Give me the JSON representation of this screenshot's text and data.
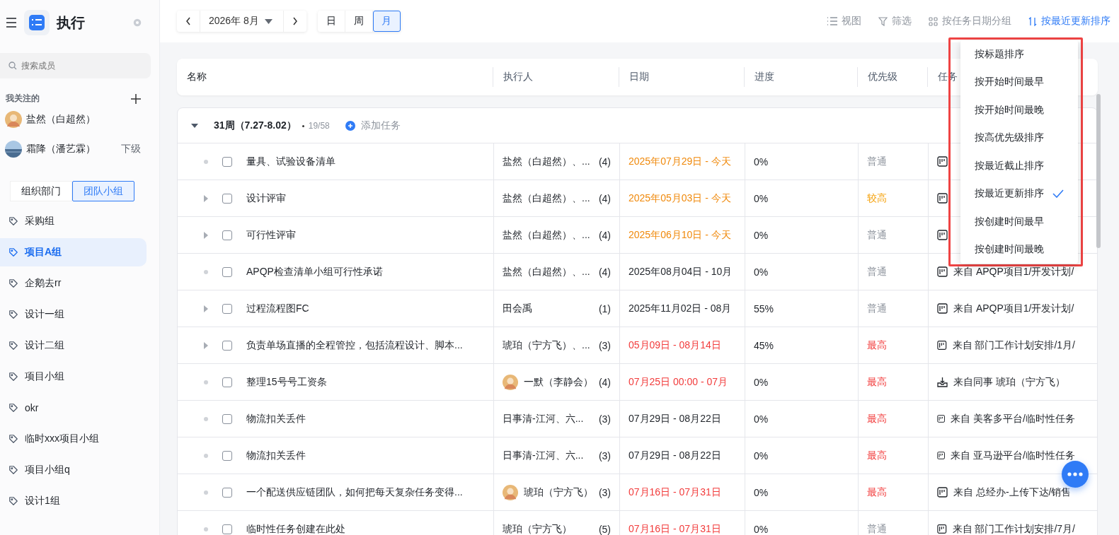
{
  "app": {
    "title": "执行"
  },
  "sidebar": {
    "search": {
      "placeholder": "搜索成员"
    },
    "following_title": "我关注的",
    "members": [
      {
        "name": "盐然（白超然）",
        "avatar": {
          "kind": "person"
        }
      },
      {
        "name": "霜降（潘艺霖）",
        "avatar": {
          "kind": "sea"
        },
        "tag": "下级"
      }
    ],
    "tabs": [
      {
        "label": "组织部门",
        "selected": false
      },
      {
        "label": "团队小组",
        "selected": true
      }
    ],
    "groups": [
      {
        "label": "采购组",
        "selected": false
      },
      {
        "label": "项目A组",
        "selected": true
      },
      {
        "label": "企鹅去rr",
        "selected": false
      },
      {
        "label": "设计一组",
        "selected": false
      },
      {
        "label": "设计二组",
        "selected": false
      },
      {
        "label": "项目小组",
        "selected": false
      },
      {
        "label": "okr",
        "selected": false
      },
      {
        "label": "临时xxx项目小组",
        "selected": false
      },
      {
        "label": "项目小组q",
        "selected": false
      },
      {
        "label": "设计1组",
        "selected": false
      }
    ]
  },
  "toolbar": {
    "month": "2026年 8月",
    "views": [
      {
        "label": "日",
        "selected": false
      },
      {
        "label": "周",
        "selected": false
      },
      {
        "label": "月",
        "selected": true
      }
    ],
    "actions": [
      {
        "kind": "view",
        "label": "视图"
      },
      {
        "kind": "filter",
        "label": "筛选"
      },
      {
        "kind": "group",
        "label": "按任务日期分组"
      },
      {
        "kind": "sort",
        "label": "按最近更新排序"
      }
    ]
  },
  "table": {
    "columns": [
      "名称",
      "执行人",
      "日期",
      "进度",
      "优先级",
      "任务"
    ],
    "group": {
      "title": "31周（7.27-8.02）",
      "count": "19/58",
      "add": "添加任务"
    },
    "rows": [
      {
        "has_children": false,
        "checked": false,
        "name": "量具、试验设备清单",
        "assignee": "盐然（白超然）、...",
        "count": "(4)",
        "date": {
          "text": "2025年07月29日 - 今天",
          "color": "#f0890b"
        },
        "progress": "0%",
        "priority": {
          "text": "普通",
          "color": "#8f959e"
        },
        "source": {
          "kind": "project"
        }
      },
      {
        "has_children": true,
        "checked": false,
        "name": "设计评审",
        "assignee": "盐然（白超然）、...",
        "count": "(4)",
        "date": {
          "text": "2025年05月03日 - 今天",
          "color": "#f0890b"
        },
        "progress": "0%",
        "priority": {
          "text": "较高",
          "color": "#f5a10a"
        },
        "source": {
          "kind": "project"
        }
      },
      {
        "has_children": true,
        "checked": false,
        "name": "可行性评审",
        "assignee": "盐然（白超然）、...",
        "count": "(4)",
        "date": {
          "text": "2025年06月10日 - 今天",
          "color": "#f0890b"
        },
        "progress": "0%",
        "priority": {
          "text": "普通",
          "color": "#8f959e"
        },
        "source": {
          "kind": "project"
        }
      },
      {
        "has_children": false,
        "checked": false,
        "name": "APQP检查清单小组可行性承诺",
        "assignee": "盐然（白超然）、...",
        "count": "(4)",
        "date": {
          "text": "2025年08月04日 - 10月",
          "color": "#1f2329"
        },
        "progress": "0%",
        "priority": {
          "text": "普通",
          "color": "#8f959e"
        },
        "source": {
          "kind": "project",
          "text": "来自 APQP项目1/开发计划/"
        }
      },
      {
        "has_children": true,
        "checked": false,
        "name": "过程流程图FC",
        "assignee": "田会禹",
        "count": "(1)",
        "date": {
          "text": "2025年11月02日 - 08月",
          "color": "#1f2329"
        },
        "progress": "55%",
        "priority": {
          "text": "普通",
          "color": "#8f959e"
        },
        "source": {
          "kind": "project",
          "text": "来自 APQP项目1/开发计划/"
        }
      },
      {
        "has_children": true,
        "checked": false,
        "name": "负责单场直播的全程管控，包括流程设计、脚本...",
        "assignee": "琥珀（宁方飞）、...",
        "count": "(3)",
        "date": {
          "text": "05月09日 - 08月14日",
          "color": "#f23c3c"
        },
        "progress": "45%",
        "priority": {
          "text": "最高",
          "color": "#f23c3c"
        },
        "source": {
          "kind": "project",
          "text": "来自 部门工作计划安排/1月/"
        }
      },
      {
        "has_children": false,
        "checked": false,
        "name": "整理15号号工资条",
        "avatar": {
          "kind": "person"
        },
        "assignee": "一默（李静会）",
        "count": "(4)",
        "date": {
          "text": "07月25日 00:00 - 07月",
          "color": "#f23c3c"
        },
        "progress": "0%",
        "priority": {
          "text": "最高",
          "color": "#f23c3c"
        },
        "source": {
          "kind": "colleague",
          "text": "来自同事 琥珀（宁方飞）"
        }
      },
      {
        "has_children": false,
        "checked": false,
        "name": "物流扣关丢件",
        "assignee": "日事清-江河、六...",
        "count": "(3)",
        "date": {
          "text": "07月29日 - 08月22日",
          "color": "#1f2329"
        },
        "progress": "0%",
        "priority": {
          "text": "最高",
          "color": "#f23c3c"
        },
        "source": {
          "kind": "project",
          "text": "来自 美客多平台/临时性任务"
        }
      },
      {
        "has_children": false,
        "checked": false,
        "name": "物流扣关丢件",
        "assignee": "日事清-江河、六...",
        "count": "(3)",
        "date": {
          "text": "07月29日 - 08月22日",
          "color": "#1f2329"
        },
        "progress": "0%",
        "priority": {
          "text": "最高",
          "color": "#f23c3c"
        },
        "source": {
          "kind": "project",
          "text": "来自 亚马逊平台/临时性任务"
        }
      },
      {
        "has_children": false,
        "checked": false,
        "name": "一个配送供应链团队，如何把每天复杂任务变得...",
        "avatar": {
          "kind": "person"
        },
        "assignee": "琥珀（宁方飞）",
        "count": "(3)",
        "date": {
          "text": "07月16日 - 07月31日",
          "color": "#f23c3c"
        },
        "progress": "0%",
        "priority": {
          "text": "最高",
          "color": "#f23c3c"
        },
        "source": {
          "kind": "project",
          "text": "来自 总经办-上传下达/销售"
        }
      },
      {
        "has_children": false,
        "checked": false,
        "name": "临时性任务创建在此处",
        "assignee": "琥珀（宁方飞）",
        "count": "(5)",
        "date": {
          "text": "07月16日 - 07月31日",
          "color": "#f23c3c"
        },
        "progress": "0%",
        "priority": {
          "text": "普通",
          "color": "#8f959e"
        },
        "source": {
          "kind": "project",
          "text": "来自 部门工作计划安排/7月/"
        }
      }
    ]
  },
  "sort_menu": [
    {
      "label": "按标题排序",
      "selected": false
    },
    {
      "label": "按开始时间最早",
      "selected": false
    },
    {
      "label": "按开始时间最晚",
      "selected": false
    },
    {
      "label": "按高优先级排序",
      "selected": false
    },
    {
      "label": "按最近截止排序",
      "selected": false
    },
    {
      "label": "按最近更新排序",
      "selected": true
    },
    {
      "label": "按创建时间最早",
      "selected": false
    },
    {
      "label": "按创建时间最晚",
      "selected": false
    }
  ]
}
